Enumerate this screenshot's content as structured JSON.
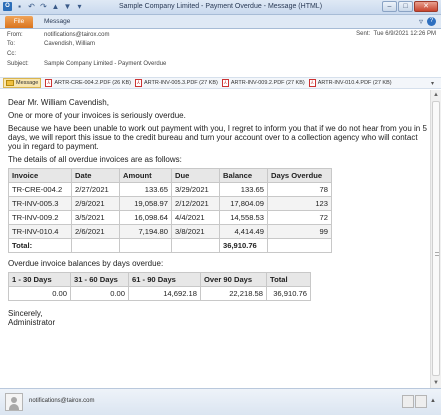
{
  "window": {
    "title": "Sample Company Limited - Payment Overdue - Message (HTML)",
    "minimize": "–",
    "maximize": "□",
    "close": "✕"
  },
  "ribbon": {
    "file_tab": "File",
    "message_tab": "Message"
  },
  "header": {
    "from_label": "From:",
    "from_value": "notifications@tairox.com",
    "to_label": "To:",
    "to_value": "Cavendish, William",
    "cc_label": "Cc:",
    "cc_value": "",
    "subject_label": "Subject:",
    "subject_value": "Sample Company Limited - Payment Overdue",
    "sent_label": "Sent:",
    "sent_value": "Tue 6/9/2021 12:26 PM"
  },
  "attachments": [
    {
      "label": "Message",
      "type": "message"
    },
    {
      "label": "ARTR-CRE-004.2.PDF (26 KB)",
      "type": "pdf"
    },
    {
      "label": "ARTR-INV-005.3.PDF (27 KB)",
      "type": "pdf"
    },
    {
      "label": "ARTR-INV-009.2.PDF (27 KB)",
      "type": "pdf"
    },
    {
      "label": "ARTR-INV-010.4.PDF (27 KB)",
      "type": "pdf"
    }
  ],
  "body": {
    "greeting": "Dear Mr. William Cavendish,",
    "line1": "One or more of your invoices is seriously overdue.",
    "line2": "Because we have been unable to work out payment with you, I regret to inform you that if we do not hear from you in 5 days, we will report this issue to the credit bureau and turn your account over to a collection agency who will contact you in regard to payment.",
    "line3": "The details of all overdue invoices are as follows:",
    "invoice_headers": [
      "Invoice",
      "Date",
      "Amount",
      "Due",
      "Balance",
      "Days Overdue"
    ],
    "invoices": [
      [
        "TR-CRE-004.2",
        "2/27/2021",
        "133.65",
        "3/29/2021",
        "133.65",
        "78"
      ],
      [
        "TR-INV-005.3",
        "2/9/2021",
        "19,058.97",
        "2/12/2021",
        "17,804.09",
        "123"
      ],
      [
        "TR-INV-009.2",
        "3/5/2021",
        "16,098.64",
        "4/4/2021",
        "14,558.53",
        "72"
      ],
      [
        "TR-INV-010.4",
        "2/6/2021",
        "7,194.80",
        "3/8/2021",
        "4,414.49",
        "99"
      ]
    ],
    "total_label": "Total:",
    "total_value": "36,910.76",
    "line4": "Overdue invoice balances by days overdue:",
    "bucket_headers": [
      "1 - 30 Days",
      "31 - 60 Days",
      "61 - 90 Days",
      "Over 90 Days",
      "Total"
    ],
    "bucket_values": [
      "0.00",
      "0.00",
      "14,692.18",
      "22,218.58",
      "36,910.76"
    ],
    "sincerely": "Sincerely,",
    "signature": "Administrator"
  },
  "statusbar": {
    "email": "notifications@tairox.com"
  }
}
